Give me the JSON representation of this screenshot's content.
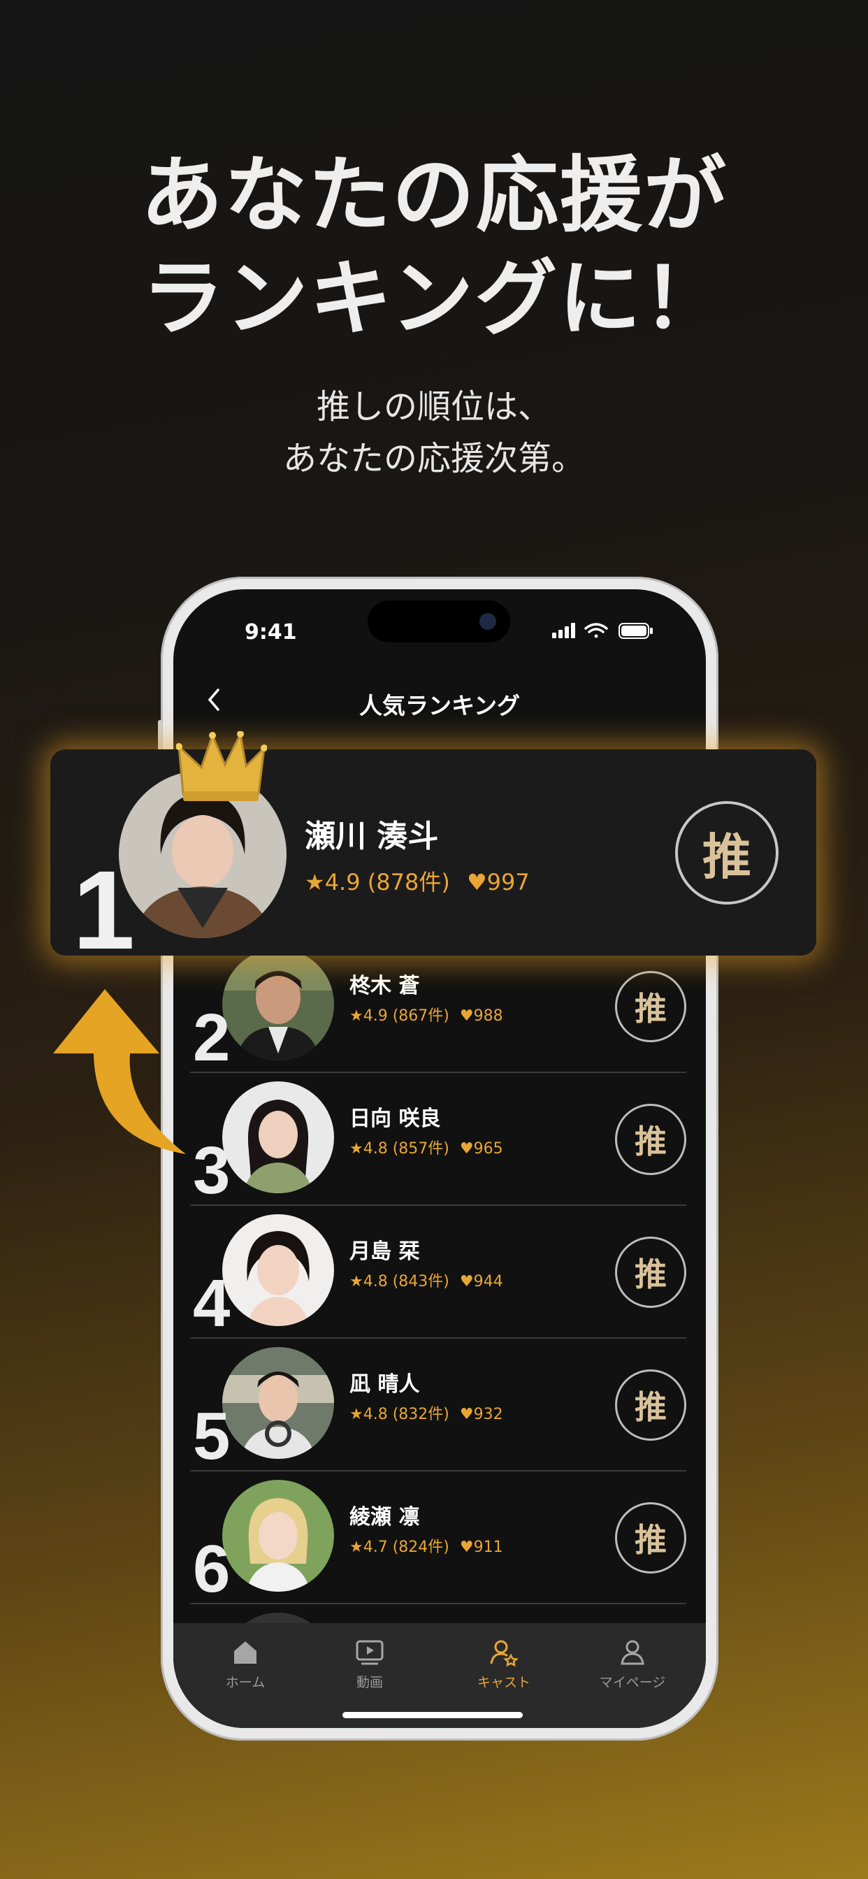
{
  "headline": {
    "line1": "あなたの応援が",
    "line2": "ランキングに！"
  },
  "subline": {
    "line1": "推しの順位は、",
    "line2": "あなたの応援次第。"
  },
  "status_bar": {
    "time": "9:41"
  },
  "nav": {
    "title": "人気ランキング"
  },
  "featured": {
    "rank": "1",
    "name": "瀬川 湊斗",
    "rating": "4.9 (878件)",
    "likes": "997",
    "button": "推"
  },
  "rows": [
    {
      "rank": "2",
      "name": "柊木 蒼",
      "rating": "4.9 (867件)",
      "likes": "988",
      "button": "推"
    },
    {
      "rank": "3",
      "name": "日向 咲良",
      "rating": "4.8 (857件)",
      "likes": "965",
      "button": "推"
    },
    {
      "rank": "4",
      "name": "月島 栞",
      "rating": "4.8 (843件)",
      "likes": "944",
      "button": "推"
    },
    {
      "rank": "5",
      "name": "凪 晴人",
      "rating": "4.8 (832件)",
      "likes": "932",
      "button": "推"
    },
    {
      "rank": "6",
      "name": "綾瀬 凛",
      "rating": "4.7 (824件)",
      "likes": "911",
      "button": "推"
    }
  ],
  "tabs": [
    {
      "label": "ホーム",
      "icon": "home-icon"
    },
    {
      "label": "動画",
      "icon": "video-icon"
    },
    {
      "label": "キャスト",
      "icon": "cast-icon",
      "active": true
    },
    {
      "label": "マイページ",
      "icon": "person-icon"
    }
  ],
  "colors": {
    "accent": "#e8a635",
    "card": "#1b1b1b",
    "tabbar": "#2a2a2a"
  }
}
